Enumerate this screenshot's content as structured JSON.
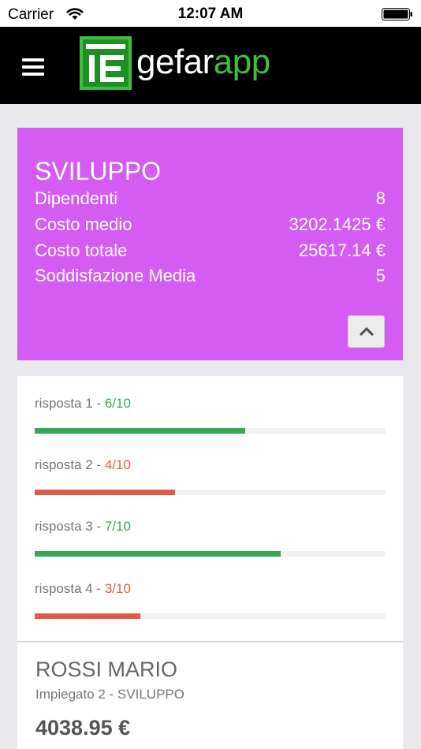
{
  "status_bar": {
    "carrier": "Carrier",
    "time": "12:07 AM",
    "icons": [
      "wifi-icon",
      "battery-icon"
    ]
  },
  "header": {
    "logo_text_white": "gefar",
    "logo_text_green": "app",
    "icons": [
      "menu-icon",
      "gefarapp-logo-icon"
    ],
    "colors": {
      "background": "#000000",
      "green": "#3fbf3f"
    }
  },
  "department": {
    "name": "SVILUPPO",
    "color": "#d45cf2",
    "rows": [
      {
        "label": "Dipendenti",
        "value": "8"
      },
      {
        "label": "Costo medio",
        "value": "3202.1425 €"
      },
      {
        "label": "Costo totale",
        "value": "25617.14 €"
      },
      {
        "label": "Soddisfazione Media",
        "value": "5"
      }
    ],
    "collapse_icon": "chevron-up-icon"
  },
  "answers": [
    {
      "label": "risposta 1 - ",
      "score": "6/10",
      "value": 6,
      "max": 10,
      "status": "good"
    },
    {
      "label": "risposta 2 - ",
      "score": "4/10",
      "value": 4,
      "max": 10,
      "status": "bad"
    },
    {
      "label": "risposta 3 - ",
      "score": "7/10",
      "value": 7,
      "max": 10,
      "status": "good"
    },
    {
      "label": "risposta 4 - ",
      "score": "3/10",
      "value": 3,
      "max": 10,
      "status": "bad"
    }
  ],
  "status_colors": {
    "good": "#33a852",
    "bad": "#e05a44"
  },
  "employee": {
    "name": "ROSSI MARIO",
    "role": "Impiegato 2 - SVILUPPO",
    "salary": "4038.95 €"
  }
}
